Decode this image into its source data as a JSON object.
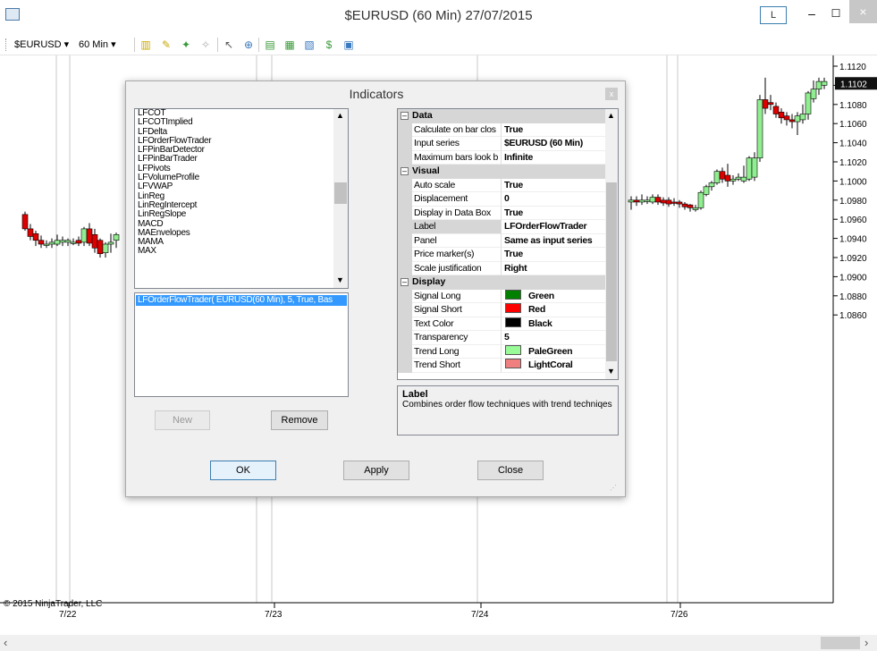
{
  "window": {
    "title": "$EURUSD (60 Min)  27/07/2015",
    "l_button": "L",
    "minimize": "–",
    "maximize": "☐",
    "close": "×"
  },
  "toolbar": {
    "instrument": "$EURUSD ▾",
    "period": "60 Min ▾"
  },
  "chart": {
    "price_labels": [
      "1.1120",
      "1.1100",
      "1.1080",
      "1.1060",
      "1.1040",
      "1.1020",
      "1.1000",
      "1.0980",
      "1.0960",
      "1.0940",
      "1.0920",
      "1.0900",
      "1.0880",
      "1.0860"
    ],
    "current_price": "1.1102",
    "date_labels": [
      "7/22",
      "7/23",
      "7/24",
      "7/26"
    ],
    "copyright": "© 2015 NinjaTrader, LLC",
    "colors": {
      "up": "#90ee90",
      "down": "#dd0000",
      "axis": "#000000",
      "grid": "#c8c8c8"
    }
  },
  "dialog": {
    "title": "Indicators",
    "close": "x",
    "indicator_list": [
      "LFCOT",
      "LFCOTImplied",
      "LFDelta",
      "LFOrderFlowTrader",
      "LFPinBarDetector",
      "LFPinBarTrader",
      "LFPivots",
      "LFVolumeProfile",
      "LFVWAP",
      "LinReg",
      "LinRegIntercept",
      "LinRegSlope",
      "MACD",
      "MAEnvelopes",
      "MAMA",
      "MAX"
    ],
    "applied": [
      "LFOrderFlowTrader( EURUSD(60 Min), 5, True, Bas"
    ],
    "buttons": {
      "new": "New",
      "remove": "Remove",
      "ok": "OK",
      "apply": "Apply",
      "close": "Close"
    },
    "properties": [
      {
        "category": "Data",
        "items": [
          {
            "name": "Calculate on bar clos",
            "value": "True"
          },
          {
            "name": "Input series",
            "value": "$EURUSD (60 Min)"
          },
          {
            "name": "Maximum bars look b",
            "value": "Infinite"
          }
        ]
      },
      {
        "category": "Visual",
        "items": [
          {
            "name": "Auto scale",
            "value": "True"
          },
          {
            "name": "Displacement",
            "value": "0"
          },
          {
            "name": "Display in Data Box",
            "value": "True"
          },
          {
            "name": "Label",
            "value": "LFOrderFlowTrader"
          },
          {
            "name": "Panel",
            "value": "Same as input series"
          },
          {
            "name": "Price marker(s)",
            "value": "True"
          },
          {
            "name": "Scale justification",
            "value": "Right"
          }
        ]
      },
      {
        "category": "Display",
        "items": [
          {
            "name": "Signal Long",
            "value": "Green",
            "color": "#008000"
          },
          {
            "name": "Signal Short",
            "value": "Red",
            "color": "#ff0000"
          },
          {
            "name": "Text Color",
            "value": "Black",
            "color": "#000000"
          },
          {
            "name": "Transparency",
            "value": "5"
          },
          {
            "name": "Trend Long",
            "value": "PaleGreen",
            "color": "#98fb98"
          },
          {
            "name": "Trend Short",
            "value": "LightCoral",
            "color": "#f08080"
          }
        ]
      }
    ],
    "description": {
      "label": "Label",
      "text": "Combines order flow techniques with trend techniqes"
    }
  }
}
